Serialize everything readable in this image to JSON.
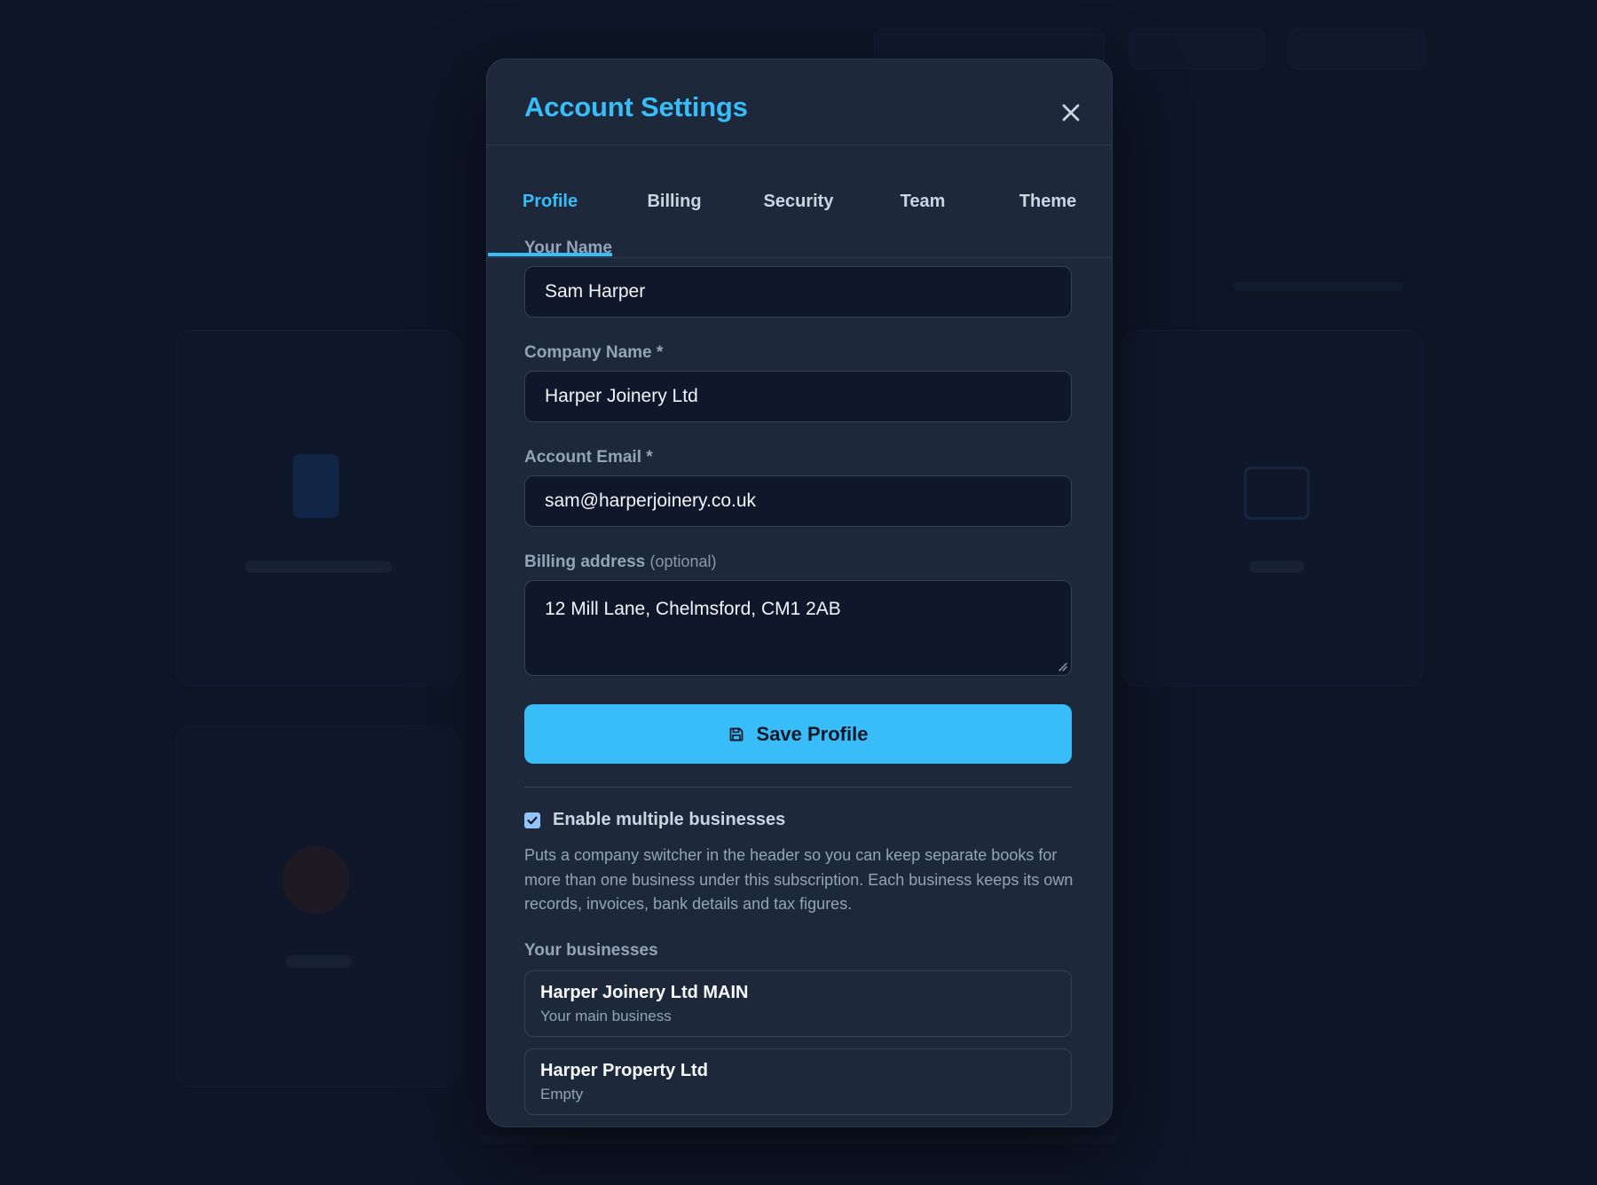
{
  "modal": {
    "title": "Account Settings",
    "close_label": "close"
  },
  "tabs": [
    {
      "label": "Profile",
      "active": true
    },
    {
      "label": "Billing",
      "active": false
    },
    {
      "label": "Security",
      "active": false
    },
    {
      "label": "Team",
      "active": false
    },
    {
      "label": "Theme",
      "active": false
    }
  ],
  "form": {
    "name_label": "Your Name",
    "name_value": "Sam Harper",
    "company_label": "Company Name *",
    "company_value": "Harper Joinery Ltd",
    "email_label": "Account Email *",
    "email_value": "sam@harperjoinery.co.uk",
    "address_label": "Billing address",
    "address_optional": "(optional)",
    "address_value": "12 Mill Lane, Chelmsford, CM1 2AB",
    "save_label": "Save Profile",
    "save_icon": "save-icon"
  },
  "multi_business": {
    "checked": true,
    "label": "Enable multiple businesses",
    "help": "Puts a company switcher in the header so you can keep separate books for more than one business under this subscription. Each business keeps its own records, invoices, bank details and tax figures.",
    "section_title": "Your businesses",
    "businesses": [
      {
        "name": "Harper Joinery Ltd MAIN",
        "subtitle": "Your main business"
      },
      {
        "name": "Harper Property Ltd",
        "subtitle": "Empty"
      }
    ]
  },
  "colors": {
    "accent": "#38bdf8",
    "modal_bg": "#1d293b",
    "backdrop": "#0d1526",
    "input_bg": "#0f172a"
  }
}
